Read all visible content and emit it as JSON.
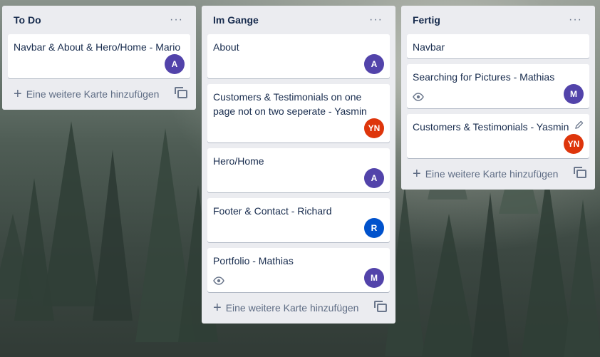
{
  "colors": {
    "avatar_a": "#5243aa",
    "avatar_yn": "#de350b",
    "avatar_r": "#0052cc",
    "avatar_m": "#5243aa"
  },
  "board": {
    "lists": [
      {
        "title": "To Do",
        "menu": "···",
        "add_label": "Eine weitere Karte hinzufügen",
        "cards": [
          {
            "text": "Navbar & About & Hero/Home - Mario",
            "avatar": "A"
          }
        ]
      },
      {
        "title": "Im Gange",
        "menu": "···",
        "add_label": "Eine weitere Karte hinzufügen",
        "cards": [
          {
            "text": "About",
            "avatar": "A"
          },
          {
            "text": "Customers & Testimonials on one page not on two seperate - Yasmin",
            "avatar": "YN"
          },
          {
            "text": "Hero/Home",
            "avatar": "A"
          },
          {
            "text": "Footer & Contact - Richard",
            "avatar": "R"
          },
          {
            "text": "Portfolio - Mathias",
            "avatar": "M",
            "icon": "eye-icon"
          }
        ]
      },
      {
        "title": "Fertig",
        "menu": "···",
        "add_label": "Eine weitere Karte hinzufügen",
        "cards": [
          {
            "text": "Navbar"
          },
          {
            "text": "Searching for Pictures - Mathias",
            "avatar": "M",
            "icon": "eye-icon"
          },
          {
            "text": "Customers & Testimonials - Yasmin",
            "avatar": "YN",
            "icon": "pencil-icon"
          }
        ]
      }
    ]
  }
}
